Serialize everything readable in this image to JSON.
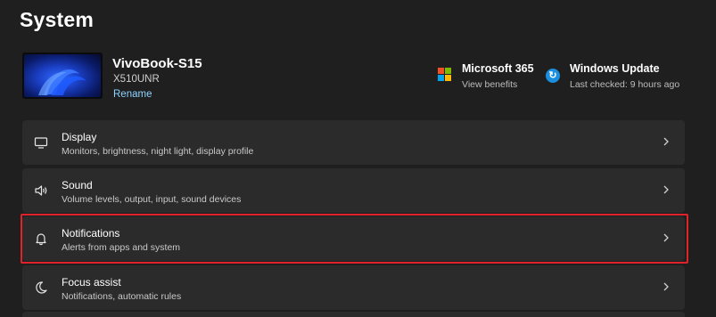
{
  "page": {
    "title": "System"
  },
  "device": {
    "name": "VivoBook-S15",
    "model": "X510UNR",
    "rename_label": "Rename"
  },
  "quick_links": {
    "microsoft365": {
      "title": "Microsoft 365",
      "subtitle": "View benefits"
    },
    "windows_update": {
      "title": "Windows Update",
      "subtitle": "Last checked: 9 hours ago"
    }
  },
  "settings": [
    {
      "title": "Display",
      "subtitle": "Monitors, brightness, night light, display profile",
      "icon": "monitor-icon"
    },
    {
      "title": "Sound",
      "subtitle": "Volume levels, output, input, sound devices",
      "icon": "speaker-icon"
    },
    {
      "title": "Notifications",
      "subtitle": "Alerts from apps and system",
      "icon": "bell-icon",
      "highlighted": true
    },
    {
      "title": "Focus assist",
      "subtitle": "Notifications, automatic rules",
      "icon": "moon-icon"
    }
  ],
  "colors": {
    "background": "#1f1f1f",
    "card": "#2b2b2b",
    "link": "#8fd3ff",
    "highlight": "#e0222a",
    "ms_red": "#f25022",
    "ms_green": "#7fba00",
    "ms_blue": "#00a4ef",
    "ms_yellow": "#ffb900",
    "update_blue": "#1a8fe0"
  }
}
